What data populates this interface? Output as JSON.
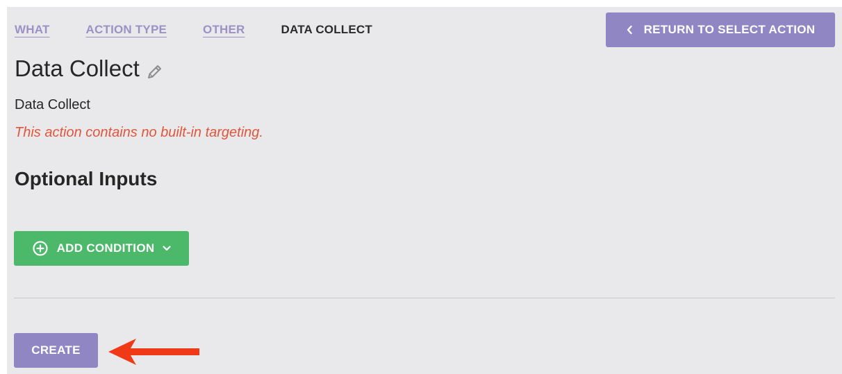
{
  "breadcrumb": {
    "items": [
      {
        "label": "WHAT"
      },
      {
        "label": "ACTION TYPE"
      },
      {
        "label": "OTHER"
      }
    ],
    "current": "DATA COLLECT"
  },
  "header": {
    "return_label": "RETURN TO SELECT ACTION",
    "return_icon": "chevron-left-icon"
  },
  "action": {
    "title": "Data Collect",
    "edit_icon": "pencil-icon",
    "description": "Data Collect",
    "warning": "This action contains no built-in targeting."
  },
  "optional_inputs": {
    "heading": "Optional Inputs",
    "add_condition_label": "ADD CONDITION",
    "add_icon": "plus-circle-icon",
    "dropdown_icon": "chevron-down-icon"
  },
  "footer": {
    "create_label": "CREATE",
    "annotation_icon": "red-arrow-left-icon"
  },
  "colors": {
    "accent_purple": "#9086c3",
    "link_purple": "#9b91c5",
    "success_green": "#4cb96a",
    "warning_red": "#e0553b",
    "annotation_red": "#f03a17",
    "panel_bg": "#e9e9eb"
  }
}
